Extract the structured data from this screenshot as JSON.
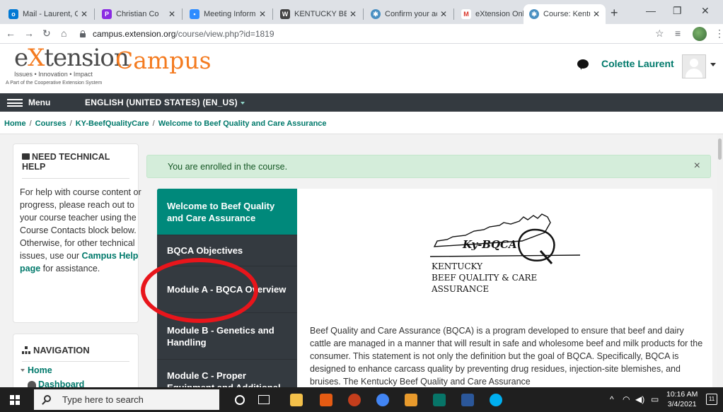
{
  "browser": {
    "tabs": [
      {
        "title": "Mail - Laurent, C",
        "icon": "outlook-icon",
        "color": "#0078d4"
      },
      {
        "title": "Christian Co",
        "icon": "pandora-icon",
        "color": "#8a2be2"
      },
      {
        "title": "Meeting Inform",
        "icon": "zoom-icon",
        "color": "#2d8cff"
      },
      {
        "title": "KENTUCKY BEEF",
        "icon": "w-icon",
        "color": "#444444"
      },
      {
        "title": "Confirm your ac",
        "icon": "extension-icon",
        "color": "#4a90c2"
      },
      {
        "title": "eXtension Onlin",
        "icon": "gmail-icon",
        "color": "#d93025"
      },
      {
        "title": "Course: Kentuck",
        "icon": "extension-icon",
        "color": "#4a90c2"
      }
    ],
    "url_host": "campus.extension.org",
    "url_path": "/course/view.php?id=1819"
  },
  "header": {
    "logo_text_ext_1": "e",
    "logo_text_ext_x": "X",
    "logo_text_ext_2": "tension",
    "logo_campus": "Campus",
    "logo_tagline": "Issues • Innovation • Impact",
    "logo_subtagline": "A Part of the Cooperative Extension System",
    "user_name": "Colette Laurent"
  },
  "nav": {
    "menu_label": "Menu",
    "language": "ENGLISH (UNITED STATES) (EN_US)"
  },
  "breadcrumb": [
    "Home",
    "Courses",
    "KY-BeefQualityCare",
    "Welcome to Beef Quality and Care Assurance"
  ],
  "help_block": {
    "title": "NEED TECHNICAL HELP",
    "text_before_link": "For help with course content or progress, please reach out to your course teacher using the Course Contacts block below.  Otherwise, for other technical issues, use our ",
    "link_text": "Campus Help page",
    "text_after_link": " for assistance."
  },
  "navigation_block": {
    "title": "NAVIGATION",
    "home": "Home",
    "dashboard": "Dashboard"
  },
  "alert": {
    "message": "You are enrolled in the course.",
    "close": "×"
  },
  "sections": [
    {
      "label": "Welcome to Beef Quality and Care Assurance"
    },
    {
      "label": "BQCA Objectives"
    },
    {
      "label": "Module A - BQCA Overview"
    },
    {
      "label": "Module B - Genetics and Handling"
    },
    {
      "label": "Module C - Proper Equipment and Additional"
    }
  ],
  "bqca_logo": {
    "mark": "Ky-BQCA",
    "line1": "KENTUCKY",
    "line2": "BEEF QUALITY & CARE",
    "line3": "ASSURANCE"
  },
  "intro_text": "Beef Quality and Care Assurance (BQCA) is a program developed to ensure that beef and dairy cattle are managed in a manner that will result in safe and wholesome beef and milk products for the consumer. This statement is not only the definition but the goal of BQCA. Specifically, BQCA is designed to enhance carcass quality by preventing drug residues, injection-site blemishes, and bruises. The Kentucky Beef Quality and Care Assurance",
  "taskbar": {
    "search_placeholder": "Type here to search",
    "time": "10:16 AM",
    "date": "3/4/2021",
    "notification_count": "11"
  }
}
